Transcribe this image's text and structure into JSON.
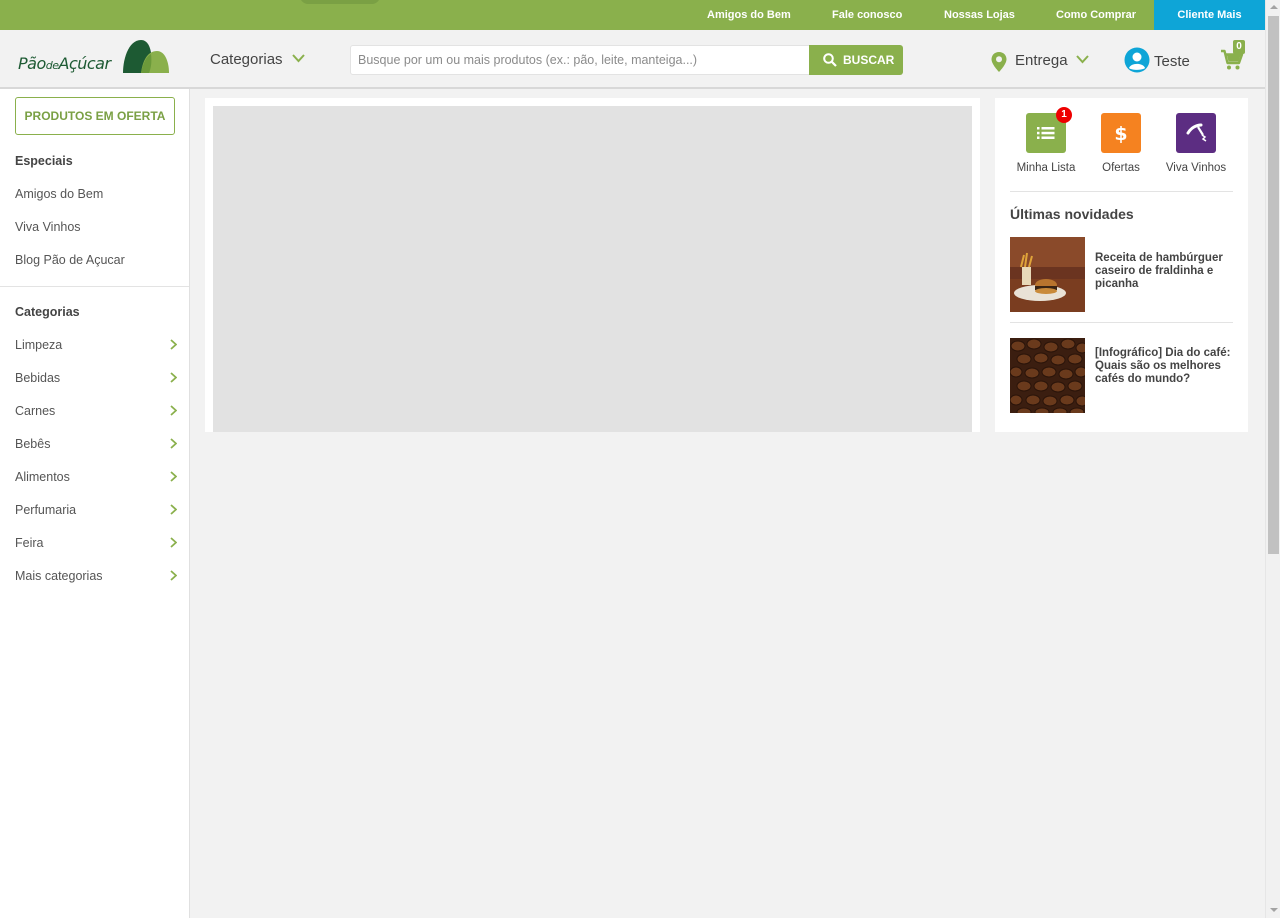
{
  "topbar": {
    "links": [
      "Amigos do Bem",
      "Fale conosco",
      "Nossas Lojas",
      "Como Comprar"
    ],
    "cliente_mais": "Cliente Mais"
  },
  "header": {
    "logo_text_1": "Pão",
    "logo_text_2": "de",
    "logo_text_3": "Açúcar",
    "categories_label": "Categorias",
    "search_placeholder": "Busque por um ou mais produtos (ex.: pão, leite, manteiga...)",
    "search_button": "BUSCAR",
    "delivery_label": "Entrega",
    "user_label": "Teste",
    "cart_count": "0"
  },
  "sidebar": {
    "offer_button": "PRODUTOS EM OFERTA",
    "specials_title": "Especiais",
    "specials": [
      "Amigos do Bem",
      "Viva Vinhos",
      "Blog Pão de Açucar"
    ],
    "categories_title": "Categorias",
    "categories": [
      "Limpeza",
      "Bebidas",
      "Carnes",
      "Bebês",
      "Alimentos",
      "Perfumaria",
      "Feira",
      "Mais categorias"
    ]
  },
  "quick_links": [
    {
      "label": "Minha Lista",
      "icon": "list-icon",
      "color": "#8ab04c",
      "badge": "1"
    },
    {
      "label": "Ofertas",
      "icon": "dollar-icon",
      "color": "#f58220"
    },
    {
      "label": "Viva Vinhos",
      "icon": "corkscrew-icon",
      "color": "#5c2d82"
    }
  ],
  "news": {
    "title": "Últimas novidades",
    "items": [
      {
        "text": "Receita de hambúrguer caseiro de fraldinha e picanha"
      },
      {
        "text": "[Infográfico] Dia do café: Quais são os melhores cafés do mundo?"
      }
    ]
  },
  "colors": {
    "brand_green": "#8ab04c",
    "cliente_blue": "#0ea5d7"
  }
}
